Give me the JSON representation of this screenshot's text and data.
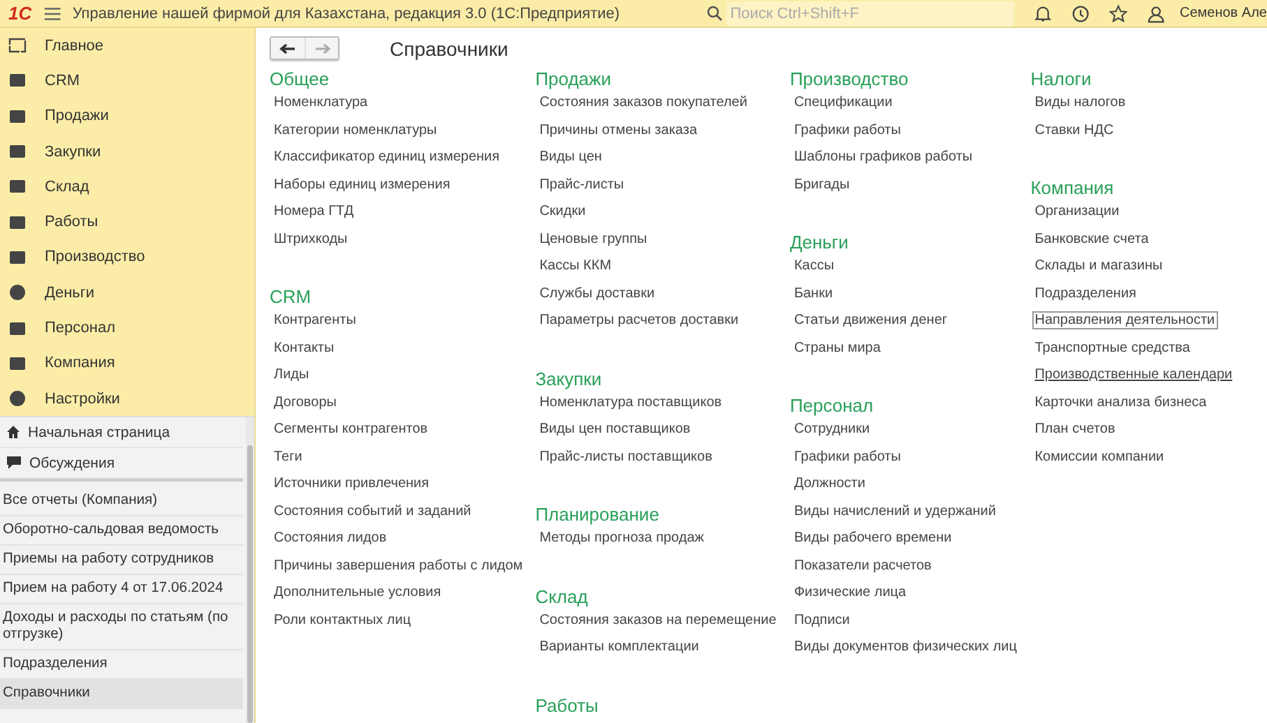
{
  "topbar": {
    "logo": "1С",
    "title": "Управление нашей фирмой для Казахстана, редакция 3.0  (1С:Предприятие)",
    "search": {
      "placeholder": "Поиск Ctrl+Shift+F"
    },
    "user": "Семенов Але"
  },
  "sidebar": {
    "sections": [
      {
        "label": "Главное",
        "selected": false
      },
      {
        "label": "CRM",
        "selected": false
      },
      {
        "label": "Продажи",
        "selected": false
      },
      {
        "label": "Закупки",
        "selected": false
      },
      {
        "label": "Склад",
        "selected": false
      },
      {
        "label": "Работы",
        "selected": false
      },
      {
        "label": "Производство",
        "selected": false
      },
      {
        "label": "Деньги",
        "selected": false
      },
      {
        "label": "Персонал",
        "selected": false
      },
      {
        "label": "Компания",
        "selected": false
      },
      {
        "label": "Настройки",
        "selected": false
      }
    ],
    "links": [
      "Начальная страница",
      "Обсуждения"
    ],
    "history": [
      {
        "label": "Все отчеты (Компания)",
        "selected": false
      },
      {
        "label": "Оборотно-сальдовая ведомость",
        "selected": false
      },
      {
        "label": "Приемы на работу сотрудников",
        "selected": false
      },
      {
        "label": "Прием на работу 4 от 17.06.2024",
        "selected": false
      },
      {
        "label": "Доходы и расходы по статьям (по отгрузке)",
        "selected": false
      },
      {
        "label": "Подразделения",
        "selected": false
      },
      {
        "label": "Справочники",
        "selected": true
      }
    ]
  },
  "page": {
    "title": "Справочники",
    "columns": [
      [
        {
          "title": "Общее",
          "items": [
            {
              "label": "Номенклатура"
            },
            {
              "label": "Категории номенклатуры"
            },
            {
              "label": "Классификатор единиц измерения"
            },
            {
              "label": "Наборы единиц измерения"
            },
            {
              "label": "Номера ГТД"
            },
            {
              "label": "Штрихкоды"
            }
          ]
        },
        {
          "title": "CRM",
          "items": [
            {
              "label": "Контрагенты"
            },
            {
              "label": "Контакты"
            },
            {
              "label": "Лиды"
            },
            {
              "label": "Договоры"
            },
            {
              "label": "Сегменты контрагентов"
            },
            {
              "label": "Теги"
            },
            {
              "label": "Источники привлечения"
            },
            {
              "label": "Состояния событий и заданий"
            },
            {
              "label": "Состояния лидов"
            },
            {
              "label": "Причины завершения работы с лидом"
            },
            {
              "label": "Дополнительные условия"
            },
            {
              "label": "Роли контактных лиц"
            }
          ]
        }
      ],
      [
        {
          "title": "Продажи",
          "items": [
            {
              "label": "Состояния заказов покупателей"
            },
            {
              "label": "Причины отмены заказа"
            },
            {
              "label": "Виды цен"
            },
            {
              "label": "Прайс-листы"
            },
            {
              "label": "Скидки"
            },
            {
              "label": "Ценовые группы"
            },
            {
              "label": "Кассы ККМ"
            },
            {
              "label": "Службы доставки"
            },
            {
              "label": "Параметры расчетов доставки"
            }
          ]
        },
        {
          "title": "Закупки",
          "items": [
            {
              "label": "Номенклатура поставщиков"
            },
            {
              "label": "Виды цен поставщиков"
            },
            {
              "label": "Прайс-листы поставщиков"
            }
          ]
        },
        {
          "title": "Планирование",
          "items": [
            {
              "label": "Методы прогноза продаж"
            }
          ]
        },
        {
          "title": "Склад",
          "items": [
            {
              "label": "Состояния заказов на перемещение"
            },
            {
              "label": "Варианты комплектации"
            }
          ]
        },
        {
          "title": "Работы"
        }
      ],
      [
        {
          "title": "Производство",
          "items": [
            {
              "label": "Спецификации"
            },
            {
              "label": "Графики работы"
            },
            {
              "label": "Шаблоны графиков работы"
            },
            {
              "label": "Бригады"
            }
          ]
        },
        {
          "title": "Деньги",
          "items": [
            {
              "label": "Кассы"
            },
            {
              "label": "Банки"
            },
            {
              "label": "Статьи движения денег"
            },
            {
              "label": "Страны мира"
            }
          ]
        },
        {
          "title": "Персонал",
          "items": [
            {
              "label": "Сотрудники"
            },
            {
              "label": "Графики работы"
            },
            {
              "label": "Должности"
            },
            {
              "label": "Виды начислений и удержаний"
            },
            {
              "label": "Виды рабочего времени"
            },
            {
              "label": "Показатели расчетов"
            },
            {
              "label": "Физические лица"
            },
            {
              "label": "Подписи"
            },
            {
              "label": "Виды документов физических лиц"
            }
          ]
        }
      ],
      [
        {
          "title": "Налоги",
          "items": [
            {
              "label": "Виды налогов"
            },
            {
              "label": "Ставки НДС"
            }
          ]
        },
        {
          "title": "Компания",
          "items": [
            {
              "label": "Организации",
              "focused": false,
              "hovered": false
            },
            {
              "label": "Банковские счета",
              "focused": false,
              "hovered": false
            },
            {
              "label": "Склады и магазины",
              "focused": false,
              "hovered": false
            },
            {
              "label": "Подразделения",
              "focused": false,
              "hovered": false
            },
            {
              "label": "Направления деятельности",
              "focused": true,
              "hovered": false
            },
            {
              "label": "Транспортные средства",
              "focused": false,
              "hovered": false
            },
            {
              "label": "Производственные календари",
              "focused": false,
              "hovered": true
            },
            {
              "label": "Карточки анализа бизнеса",
              "focused": false,
              "hovered": false
            },
            {
              "label": "План счетов",
              "focused": false,
              "hovered": false
            },
            {
              "label": "Комиссии компании",
              "focused": false,
              "hovered": false
            }
          ]
        }
      ]
    ]
  }
}
